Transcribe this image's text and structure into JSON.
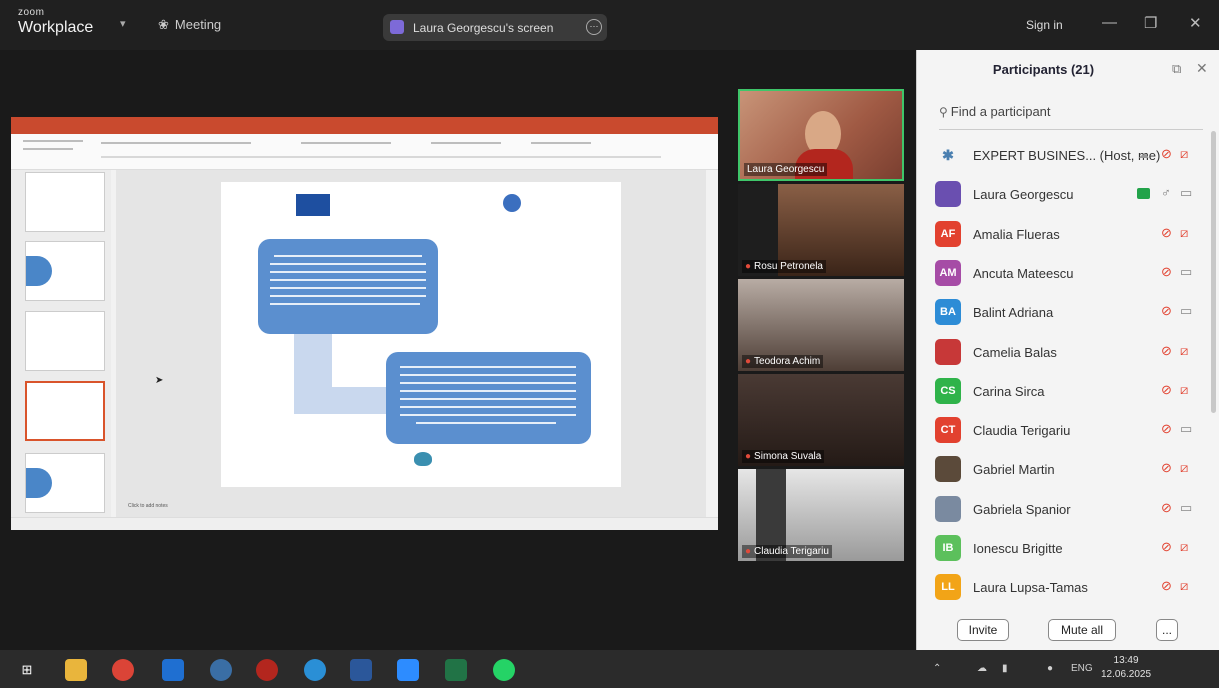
{
  "titlebar": {
    "brand_small": "zoom",
    "brand_big": "Workplace",
    "meeting_label": "Meeting",
    "share_label": "Laura Georgescu's screen",
    "sign_in": "Sign in"
  },
  "slide": {
    "notes_placeholder": "Click to add notes"
  },
  "videos": [
    {
      "name": "Laura Georgescu",
      "muted": false,
      "bg": "#a56b52"
    },
    {
      "name": "Rosu Petronela",
      "muted": true,
      "bg": "#5a3a2a"
    },
    {
      "name": "Teodora Achim",
      "muted": true,
      "bg": "#6f5c52"
    },
    {
      "name": "Simona Suvala",
      "muted": true,
      "bg": "#352a26"
    },
    {
      "name": "Claudia Terigariu",
      "muted": true,
      "bg": "#cfcfcf"
    }
  ],
  "participants": {
    "title": "Participants (21)",
    "search_placeholder": "Find a participant",
    "items": [
      {
        "name": "EXPERT BUSINES... (Host, me)",
        "initials": "",
        "color": "#f4f4f4",
        "mic": "off",
        "cam": "off"
      },
      {
        "name": "Laura Georgescu",
        "initials": "",
        "color": "#6a4fb0",
        "mic": "on",
        "cam": "on"
      },
      {
        "name": "Amalia Flueras",
        "initials": "AF",
        "color": "#e2412f",
        "mic": "off",
        "cam": "off"
      },
      {
        "name": "Ancuta Mateescu",
        "initials": "AM",
        "color": "#a64ca6",
        "mic": "off",
        "cam": "on"
      },
      {
        "name": "Balint Adriana",
        "initials": "BA",
        "color": "#2d8cd6",
        "mic": "off",
        "cam": "on"
      },
      {
        "name": "Camelia Balas",
        "initials": "",
        "color": "#c73838",
        "mic": "off",
        "cam": "off"
      },
      {
        "name": "Carina Sirca",
        "initials": "CS",
        "color": "#2fb34a",
        "mic": "off",
        "cam": "off"
      },
      {
        "name": "Claudia Terigariu",
        "initials": "CT",
        "color": "#e2412f",
        "mic": "off",
        "cam": "on"
      },
      {
        "name": "Gabriel Martin",
        "initials": "",
        "color": "#5b4a3a",
        "mic": "off",
        "cam": "off"
      },
      {
        "name": "Gabriela Spanior",
        "initials": "",
        "color": "#7a8aa0",
        "mic": "off",
        "cam": "on"
      },
      {
        "name": "Ionescu Brigitte",
        "initials": "IB",
        "color": "#5cc05c",
        "mic": "off",
        "cam": "off"
      },
      {
        "name": "Laura Lupsa-Tamas",
        "initials": "LL",
        "color": "#f2a417",
        "mic": "off",
        "cam": "off"
      }
    ],
    "invite_label": "Invite",
    "mute_all_label": "Mute all",
    "more_label": "..."
  },
  "taskbar": {
    "lang": "ENG",
    "time": "13:49",
    "date": "12.06.2025"
  }
}
